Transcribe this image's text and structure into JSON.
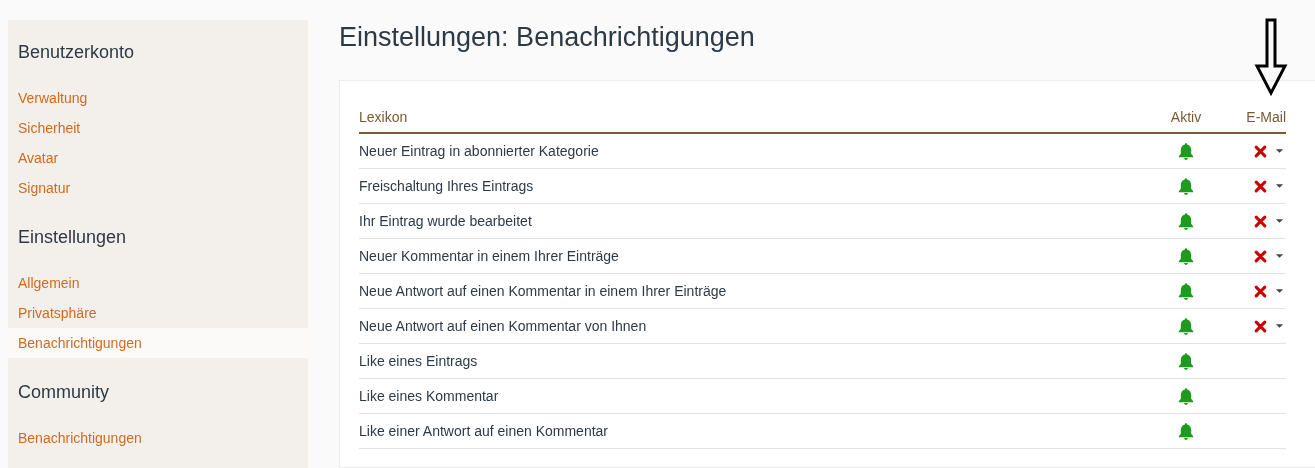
{
  "sidebar": {
    "sections": [
      {
        "heading": "Benutzerkonto",
        "items": [
          {
            "label": "Verwaltung",
            "selected": false
          },
          {
            "label": "Sicherheit",
            "selected": false
          },
          {
            "label": "Avatar",
            "selected": false
          },
          {
            "label": "Signatur",
            "selected": false
          }
        ]
      },
      {
        "heading": "Einstellungen",
        "items": [
          {
            "label": "Allgemein",
            "selected": false
          },
          {
            "label": "Privatsphäre",
            "selected": false
          },
          {
            "label": "Benachrichtigungen",
            "selected": true
          }
        ]
      },
      {
        "heading": "Community",
        "items": [
          {
            "label": "Benachrichtigungen",
            "selected": false
          }
        ]
      }
    ]
  },
  "page_title": "Einstellungen: Benachrichtigungen",
  "table": {
    "columns": [
      "Lexikon",
      "Aktiv",
      "E-Mail"
    ],
    "rows": [
      {
        "label": "Neuer Eintrag in abonnierter Kategorie",
        "active": true,
        "email": {
          "kind": "off"
        }
      },
      {
        "label": "Freischaltung Ihres Eintrags",
        "active": true,
        "email": {
          "kind": "off"
        }
      },
      {
        "label": "Ihr Eintrag wurde bearbeitet",
        "active": true,
        "email": {
          "kind": "off"
        }
      },
      {
        "label": "Neuer Kommentar in einem Ihrer Einträge",
        "active": true,
        "email": {
          "kind": "off"
        }
      },
      {
        "label": "Neue Antwort auf einen Kommentar in einem Ihrer Einträge",
        "active": true,
        "email": {
          "kind": "off"
        }
      },
      {
        "label": "Neue Antwort auf einen Kommentar von Ihnen",
        "active": true,
        "email": {
          "kind": "off"
        }
      },
      {
        "label": "Like eines Eintrags",
        "active": true
      },
      {
        "label": "Like eines Kommentar",
        "active": true
      },
      {
        "label": "Like einer Antwort auf einen Kommentar",
        "active": true
      }
    ]
  }
}
